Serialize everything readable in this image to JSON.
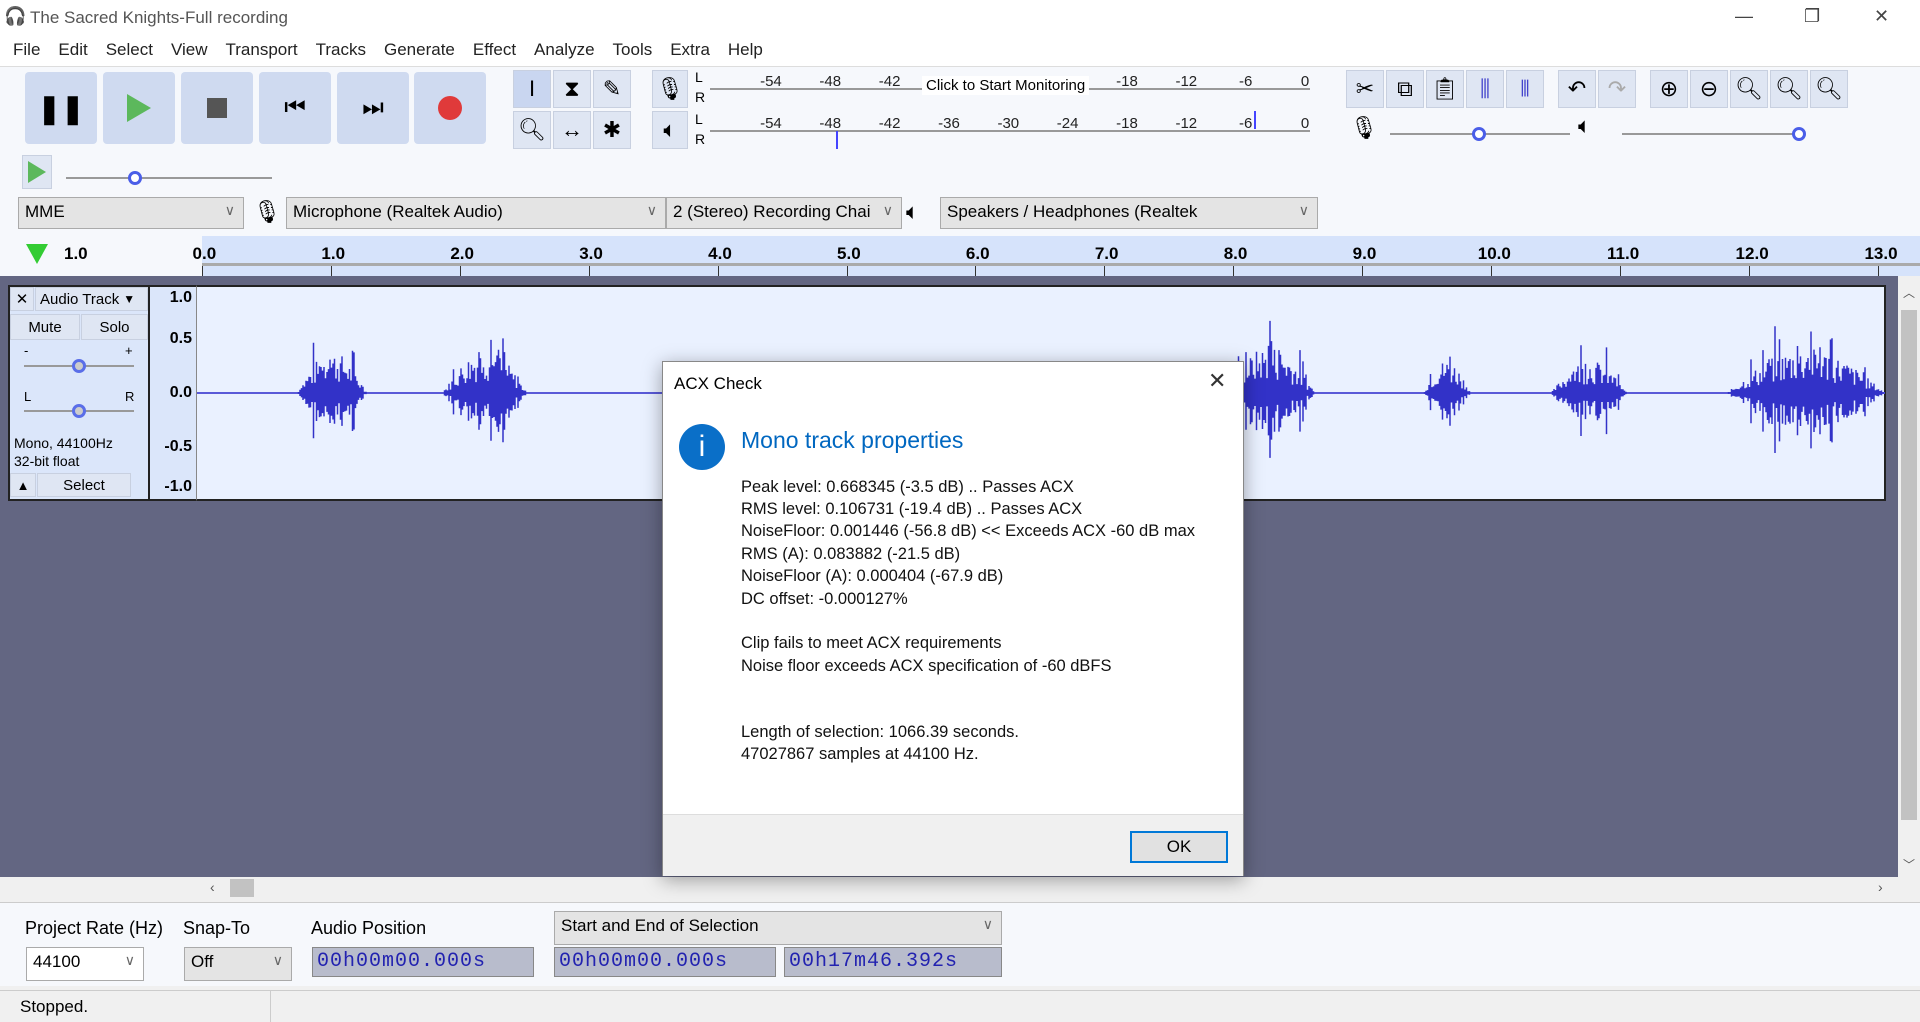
{
  "window": {
    "title": "The Sacred Knights-Full recording"
  },
  "menu": [
    "File",
    "Edit",
    "Select",
    "View",
    "Transport",
    "Tracks",
    "Generate",
    "Effect",
    "Analyze",
    "Tools",
    "Extra",
    "Help"
  ],
  "meters": {
    "record_ticks": [
      "-54",
      "-48",
      "-42",
      "-18",
      "-12",
      "-6",
      "0"
    ],
    "monitor_label": "Click to Start Monitoring",
    "play_ticks": [
      "-54",
      "-48",
      "-42",
      "-36",
      "-30",
      "-24",
      "-18",
      "-12",
      "-6",
      "0"
    ],
    "channels": [
      "L",
      "R"
    ]
  },
  "devices": {
    "host": "MME",
    "input": "Microphone (Realtek Audio)",
    "channels": "2 (Stereo) Recording Chai",
    "output": "Speakers / Headphones (Realtek"
  },
  "ruler": {
    "left_label": "1.0",
    "labels": [
      "0.0",
      "1.0",
      "2.0",
      "3.0",
      "4.0",
      "5.0",
      "6.0",
      "7.0",
      "8.0",
      "9.0",
      "10.0",
      "11.0",
      "12.0",
      "13.0"
    ]
  },
  "track": {
    "name": "Audio Track",
    "mute": "Mute",
    "solo": "Solo",
    "gain_min": "-",
    "gain_max": "+",
    "pan_left": "L",
    "pan_right": "R",
    "info1": "Mono, 44100Hz",
    "info2": "32-bit float",
    "select": "Select",
    "scale": [
      "1.0",
      "0.5",
      "0.0",
      "-0.5",
      "-1.0"
    ],
    "waveform_color": "#3232c8"
  },
  "selection_bar": {
    "project_rate_label": "Project Rate (Hz)",
    "project_rate": "44100",
    "snap_label": "Snap-To",
    "snap": "Off",
    "audio_position_label": "Audio Position",
    "audio_position": "00h00m00.000s",
    "selection_mode": "Start and End of Selection",
    "sel_start": "00h00m00.000s",
    "sel_end": "00h17m46.392s"
  },
  "status": "Stopped.",
  "dialog": {
    "title": "ACX Check",
    "heading": "Mono track properties",
    "accent": "#0067c0",
    "lines": [
      "Peak level: 0.668345 (-3.5 dB)  .. Passes ACX",
      "RMS level: 0.106731 (-19.4 dB)  .. Passes ACX",
      "NoiseFloor: 0.001446 (-56.8 dB)  << Exceeds ACX -60 dB max",
      "RMS (A): 0.083882 (-21.5 dB)",
      "NoiseFloor (A): 0.000404 (-67.9 dB)",
      "DC offset: -0.000127%"
    ],
    "verdict": [
      "Clip fails to meet ACX requirements",
      "Noise floor exceeds ACX specification of -60 dBFS"
    ],
    "length": [
      "Length of selection: 1066.39 seconds.",
      "47027867 samples at 44100 Hz."
    ],
    "ok": "OK"
  }
}
